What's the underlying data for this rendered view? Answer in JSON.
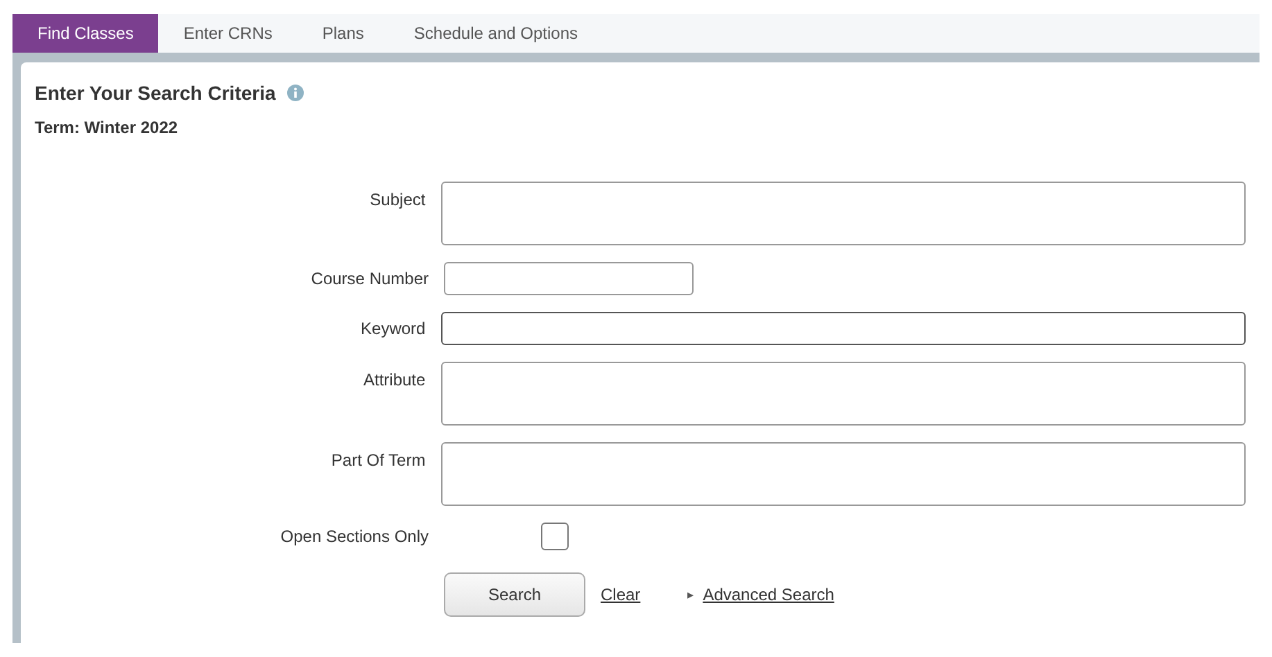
{
  "tabs": [
    {
      "label": "Find Classes",
      "selected": true
    },
    {
      "label": "Enter CRNs",
      "selected": false
    },
    {
      "label": "Plans",
      "selected": false
    },
    {
      "label": "Schedule and Options",
      "selected": false
    }
  ],
  "heading": "Enter Your Search Criteria",
  "term": "Term: Winter 2022",
  "fields": [
    {
      "label": "Subject",
      "kind": "multi"
    },
    {
      "label": "Course Number",
      "kind": "short"
    },
    {
      "label": "Keyword",
      "kind": "text"
    },
    {
      "label": "Attribute",
      "kind": "multi"
    },
    {
      "label": "Part Of Term",
      "kind": "multi"
    },
    {
      "label": "Open Sections Only",
      "kind": "checkbox",
      "checked": false
    }
  ],
  "actions": {
    "search": "Search",
    "clear": "Clear",
    "advanced_arrow": "▸",
    "advanced": "Advanced Search"
  }
}
